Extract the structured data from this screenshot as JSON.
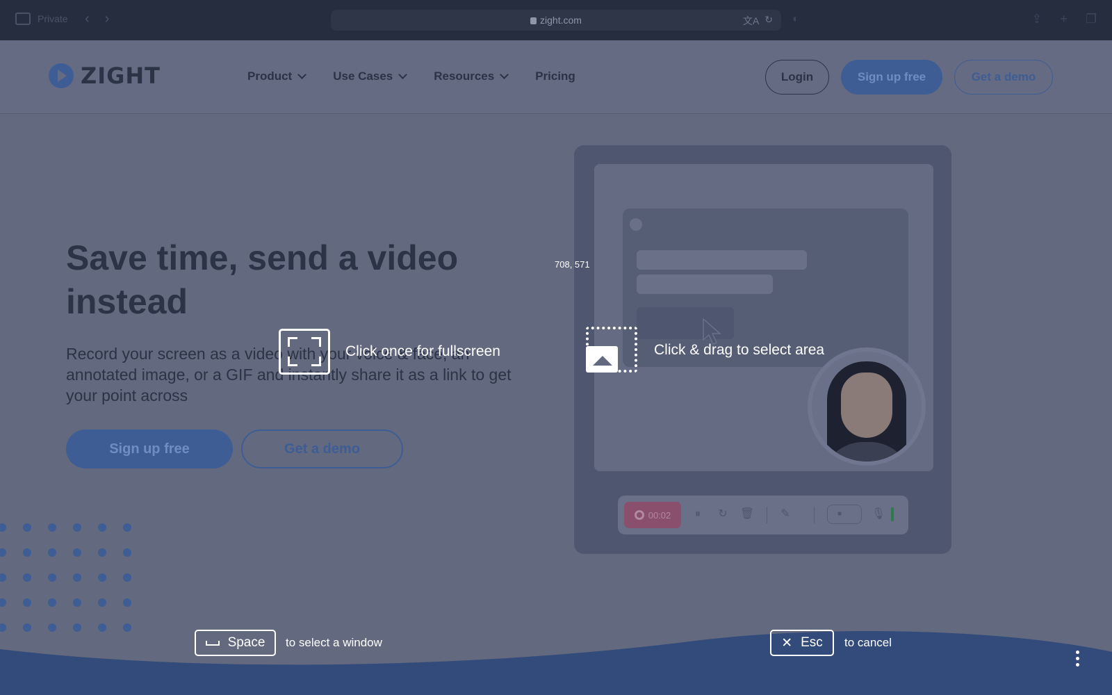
{
  "browser": {
    "private_label": "Private",
    "url": "zight.com",
    "back_glyph": "‹",
    "forward_glyph": "›",
    "translate_glyph": "文A",
    "reload_glyph": "↻",
    "shield_glyph": "◐",
    "share_glyph": "⇪",
    "newtab_glyph": "+",
    "tabs_glyph": "❐"
  },
  "site": {
    "logo_text": "ZIGHT",
    "nav": [
      {
        "label": "Product"
      },
      {
        "label": "Use Cases"
      },
      {
        "label": "Resources"
      },
      {
        "label": "Pricing"
      }
    ],
    "login_label": "Login",
    "signup_label": "Sign up free",
    "demo_label": "Get a demo"
  },
  "hero": {
    "title": "Save time, send a video instead",
    "subtitle": "Record your screen as a video with your voice & face, an annotated image, or a GIF and instantly share it as a link to get your point across",
    "signup_label": "Sign up free",
    "demo_label": "Get a demo"
  },
  "illustration": {
    "timer": "00:02",
    "pause_glyph": "⏸",
    "redo_glyph": "↻",
    "trash_glyph": "🗑",
    "draw_glyph": "✎",
    "camera_glyph": "■",
    "mic_glyph": "🎙"
  },
  "overlay": {
    "cursor_coords": "708, 571",
    "fullscreen_hint": "Click once for fullscreen",
    "area_hint": "Click & drag to select area",
    "space_key": "Space",
    "space_hint": "to select a window",
    "esc_key": "Esc",
    "esc_hint": "to cancel",
    "esc_glyph": "✕"
  },
  "colors": {
    "dim_overlay": "#63697f",
    "brand_blue": "#3e5d95",
    "dark_text": "#2b3347",
    "white": "#ffffff"
  }
}
